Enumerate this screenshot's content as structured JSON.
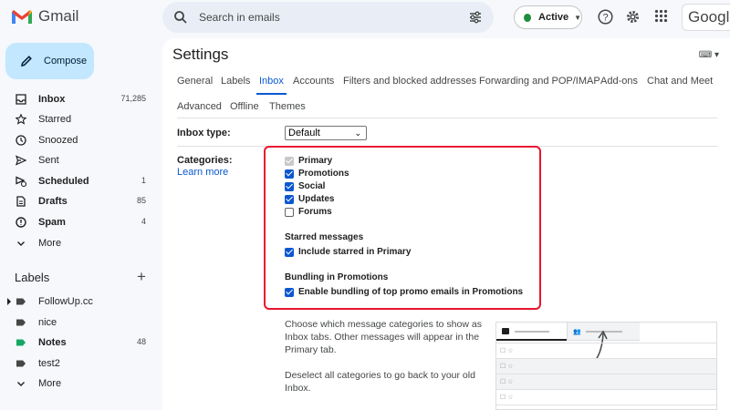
{
  "app": {
    "logo_text": "Gmail",
    "google_word": "Google"
  },
  "search": {
    "placeholder": "Search in emails"
  },
  "status": {
    "label": "Active",
    "color": "#1e8e3e"
  },
  "compose": {
    "label": "Compose"
  },
  "nav": [
    {
      "name": "inbox",
      "label": "Inbox",
      "count": "71,285",
      "bold": true
    },
    {
      "name": "starred",
      "label": "Starred",
      "count": "",
      "bold": false
    },
    {
      "name": "snoozed",
      "label": "Snoozed",
      "count": "",
      "bold": false
    },
    {
      "name": "sent",
      "label": "Sent",
      "count": "",
      "bold": false
    },
    {
      "name": "scheduled",
      "label": "Scheduled",
      "count": "1",
      "bold": true
    },
    {
      "name": "drafts",
      "label": "Drafts",
      "count": "85",
      "bold": true
    },
    {
      "name": "spam",
      "label": "Spam",
      "count": "4",
      "bold": true
    },
    {
      "name": "more",
      "label": "More",
      "count": "",
      "bold": false
    }
  ],
  "labels": {
    "heading": "Labels",
    "items": [
      {
        "label": "FollowUp.cc",
        "count": "",
        "bold": false,
        "color": "#444746"
      },
      {
        "label": "nice",
        "count": "",
        "bold": false,
        "color": "#444746"
      },
      {
        "label": "Notes",
        "count": "48",
        "bold": true,
        "color": "#16a765"
      },
      {
        "label": "test2",
        "count": "",
        "bold": false,
        "color": "#444746"
      },
      {
        "label": "More",
        "count": "",
        "bold": false,
        "color": ""
      }
    ]
  },
  "settings": {
    "title": "Settings",
    "tabs": [
      "General",
      "Labels",
      "Inbox",
      "Accounts",
      "Filters and blocked addresses",
      "Forwarding and POP/IMAP",
      "Add-ons",
      "Chat and Meet",
      "Advanced",
      "Offline",
      "Themes"
    ],
    "active_tab": "Inbox",
    "inbox_type": {
      "label": "Inbox type:",
      "value": "Default"
    },
    "categories": {
      "label": "Categories:",
      "learn_more": "Learn more",
      "items": [
        {
          "label": "Primary",
          "state": "disabled-checked"
        },
        {
          "label": "Promotions",
          "state": "checked"
        },
        {
          "label": "Social",
          "state": "checked"
        },
        {
          "label": "Updates",
          "state": "checked"
        },
        {
          "label": "Forums",
          "state": "unchecked"
        }
      ],
      "starred_heading": "Starred messages",
      "starred_option": {
        "label": "Include starred in Primary",
        "state": "checked"
      },
      "bundling_heading": "Bundling in Promotions",
      "bundling_option": {
        "label": "Enable bundling of top promo emails in Promotions",
        "state": "checked"
      },
      "description_1": [
        "Choose which message categories to show as",
        "Inbox tabs. Other messages will appear in the",
        "Primary tab."
      ],
      "description_2": [
        "Deselect all categories to go back to your old",
        "Inbox."
      ]
    }
  },
  "colors": {
    "accent": "#0b57d0",
    "highlight_border": "#e8152e",
    "compose_bg": "#c2e7ff"
  }
}
